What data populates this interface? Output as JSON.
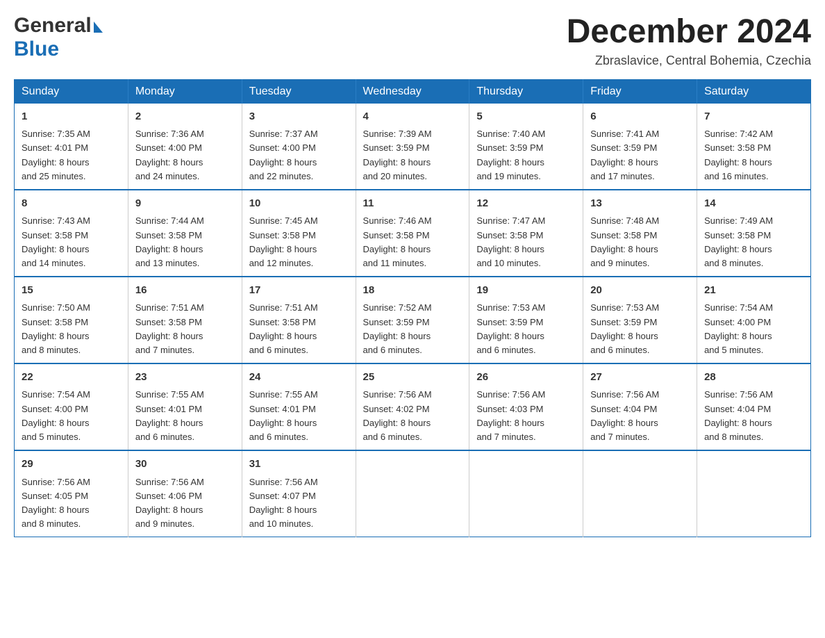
{
  "header": {
    "logo_general": "General",
    "logo_blue": "Blue",
    "month_title": "December 2024",
    "location": "Zbraslavice, Central Bohemia, Czechia"
  },
  "calendar": {
    "days_of_week": [
      "Sunday",
      "Monday",
      "Tuesday",
      "Wednesday",
      "Thursday",
      "Friday",
      "Saturday"
    ],
    "weeks": [
      [
        {
          "day": "1",
          "sunrise": "7:35 AM",
          "sunset": "4:01 PM",
          "daylight": "8 hours and 25 minutes."
        },
        {
          "day": "2",
          "sunrise": "7:36 AM",
          "sunset": "4:00 PM",
          "daylight": "8 hours and 24 minutes."
        },
        {
          "day": "3",
          "sunrise": "7:37 AM",
          "sunset": "4:00 PM",
          "daylight": "8 hours and 22 minutes."
        },
        {
          "day": "4",
          "sunrise": "7:39 AM",
          "sunset": "3:59 PM",
          "daylight": "8 hours and 20 minutes."
        },
        {
          "day": "5",
          "sunrise": "7:40 AM",
          "sunset": "3:59 PM",
          "daylight": "8 hours and 19 minutes."
        },
        {
          "day": "6",
          "sunrise": "7:41 AM",
          "sunset": "3:59 PM",
          "daylight": "8 hours and 17 minutes."
        },
        {
          "day": "7",
          "sunrise": "7:42 AM",
          "sunset": "3:58 PM",
          "daylight": "8 hours and 16 minutes."
        }
      ],
      [
        {
          "day": "8",
          "sunrise": "7:43 AM",
          "sunset": "3:58 PM",
          "daylight": "8 hours and 14 minutes."
        },
        {
          "day": "9",
          "sunrise": "7:44 AM",
          "sunset": "3:58 PM",
          "daylight": "8 hours and 13 minutes."
        },
        {
          "day": "10",
          "sunrise": "7:45 AM",
          "sunset": "3:58 PM",
          "daylight": "8 hours and 12 minutes."
        },
        {
          "day": "11",
          "sunrise": "7:46 AM",
          "sunset": "3:58 PM",
          "daylight": "8 hours and 11 minutes."
        },
        {
          "day": "12",
          "sunrise": "7:47 AM",
          "sunset": "3:58 PM",
          "daylight": "8 hours and 10 minutes."
        },
        {
          "day": "13",
          "sunrise": "7:48 AM",
          "sunset": "3:58 PM",
          "daylight": "8 hours and 9 minutes."
        },
        {
          "day": "14",
          "sunrise": "7:49 AM",
          "sunset": "3:58 PM",
          "daylight": "8 hours and 8 minutes."
        }
      ],
      [
        {
          "day": "15",
          "sunrise": "7:50 AM",
          "sunset": "3:58 PM",
          "daylight": "8 hours and 8 minutes."
        },
        {
          "day": "16",
          "sunrise": "7:51 AM",
          "sunset": "3:58 PM",
          "daylight": "8 hours and 7 minutes."
        },
        {
          "day": "17",
          "sunrise": "7:51 AM",
          "sunset": "3:58 PM",
          "daylight": "8 hours and 6 minutes."
        },
        {
          "day": "18",
          "sunrise": "7:52 AM",
          "sunset": "3:59 PM",
          "daylight": "8 hours and 6 minutes."
        },
        {
          "day": "19",
          "sunrise": "7:53 AM",
          "sunset": "3:59 PM",
          "daylight": "8 hours and 6 minutes."
        },
        {
          "day": "20",
          "sunrise": "7:53 AM",
          "sunset": "3:59 PM",
          "daylight": "8 hours and 6 minutes."
        },
        {
          "day": "21",
          "sunrise": "7:54 AM",
          "sunset": "4:00 PM",
          "daylight": "8 hours and 5 minutes."
        }
      ],
      [
        {
          "day": "22",
          "sunrise": "7:54 AM",
          "sunset": "4:00 PM",
          "daylight": "8 hours and 5 minutes."
        },
        {
          "day": "23",
          "sunrise": "7:55 AM",
          "sunset": "4:01 PM",
          "daylight": "8 hours and 6 minutes."
        },
        {
          "day": "24",
          "sunrise": "7:55 AM",
          "sunset": "4:01 PM",
          "daylight": "8 hours and 6 minutes."
        },
        {
          "day": "25",
          "sunrise": "7:56 AM",
          "sunset": "4:02 PM",
          "daylight": "8 hours and 6 minutes."
        },
        {
          "day": "26",
          "sunrise": "7:56 AM",
          "sunset": "4:03 PM",
          "daylight": "8 hours and 7 minutes."
        },
        {
          "day": "27",
          "sunrise": "7:56 AM",
          "sunset": "4:04 PM",
          "daylight": "8 hours and 7 minutes."
        },
        {
          "day": "28",
          "sunrise": "7:56 AM",
          "sunset": "4:04 PM",
          "daylight": "8 hours and 8 minutes."
        }
      ],
      [
        {
          "day": "29",
          "sunrise": "7:56 AM",
          "sunset": "4:05 PM",
          "daylight": "8 hours and 8 minutes."
        },
        {
          "day": "30",
          "sunrise": "7:56 AM",
          "sunset": "4:06 PM",
          "daylight": "8 hours and 9 minutes."
        },
        {
          "day": "31",
          "sunrise": "7:56 AM",
          "sunset": "4:07 PM",
          "daylight": "8 hours and 10 minutes."
        },
        null,
        null,
        null,
        null
      ]
    ],
    "labels": {
      "sunrise": "Sunrise:",
      "sunset": "Sunset:",
      "daylight": "Daylight:"
    }
  }
}
